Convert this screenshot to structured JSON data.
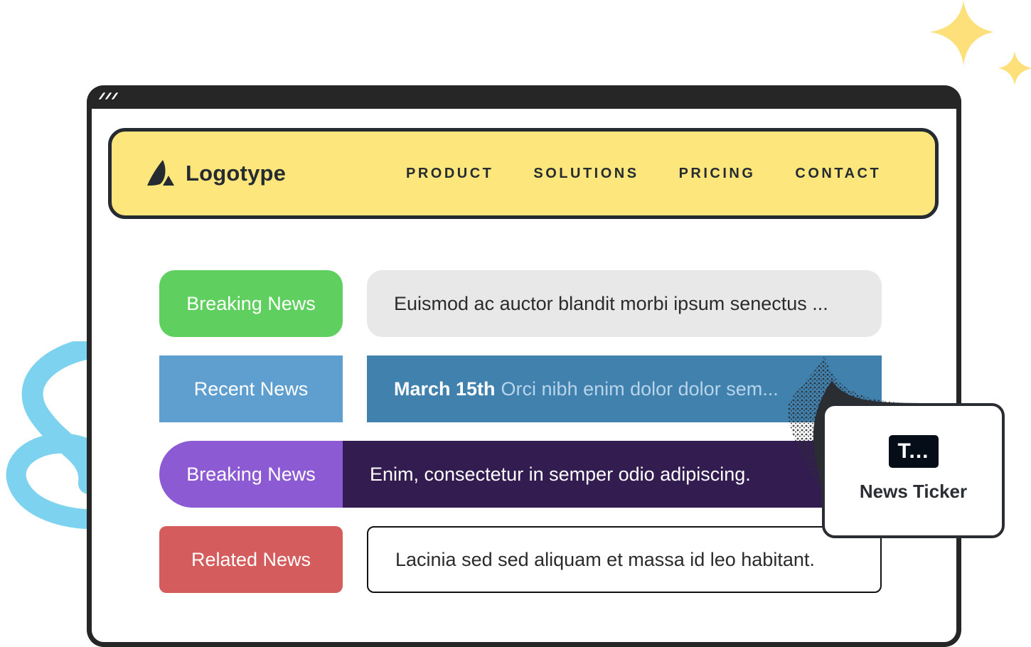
{
  "decorations": {
    "squiggle_color": "#7dd2f0",
    "sparkle_color": "#fde07a"
  },
  "window": {
    "chrome_color": "#262626"
  },
  "navbar": {
    "logo_text": "Logotype",
    "background": "#fde77c",
    "items": [
      {
        "label": "PRODUCT"
      },
      {
        "label": "SOLUTIONS"
      },
      {
        "label": "PRICING"
      },
      {
        "label": "CONTACT"
      }
    ]
  },
  "tickers": [
    {
      "label": "Breaking News",
      "text": "Euismod ac auctor blandit morbi ipsum senectus ...",
      "label_color": "#5fd05f",
      "content_color": "#e8e8e8"
    },
    {
      "label": "Recent News",
      "date": "March 15th",
      "text": "Orci nibh enim dolor dolor sem...",
      "label_color": "#5f9fd0",
      "content_color": "#4181ae"
    },
    {
      "label": "Breaking News",
      "text": "Enim, consectetur in semper odio adipiscing.",
      "label_color": "#8c5ad3",
      "content_color": "#331c50"
    },
    {
      "label": "Related News",
      "text": "Lacinia sed sed aliquam et massa id leo habitant.",
      "label_color": "#d45c5c",
      "content_color": "#ffffff"
    }
  ],
  "widget_card": {
    "icon_text": "T...",
    "title": "News Ticker"
  }
}
